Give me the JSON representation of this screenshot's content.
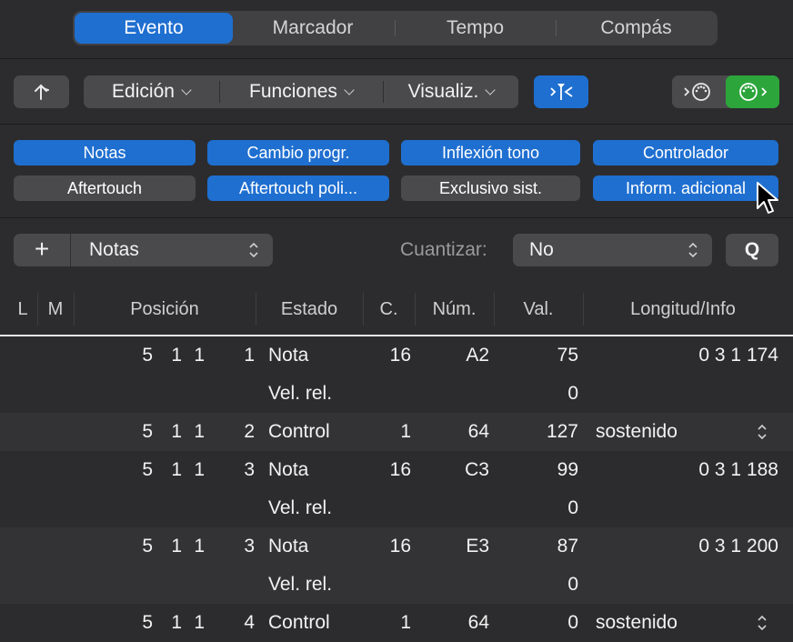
{
  "tabs": [
    "Evento",
    "Marcador",
    "Tempo",
    "Compás"
  ],
  "toolbar": {
    "up_button_icon": "arrow-up-icon",
    "edicion_label": "Edición",
    "funciones_label": "Funciones",
    "visualiz_label": "Visualiz.",
    "midi_in_icon": "midi-in-icon",
    "midi_out_icon": "midi-out-icon",
    "catch_icon": "catch-playhead-icon"
  },
  "filters": [
    {
      "label": "Notas",
      "on": true
    },
    {
      "label": "Cambio progr.",
      "on": true
    },
    {
      "label": "Inflexión tono",
      "on": true
    },
    {
      "label": "Controlador",
      "on": true
    },
    {
      "label": "Aftertouch",
      "on": false
    },
    {
      "label": "Aftertouch poli...",
      "on": true
    },
    {
      "label": "Exclusivo sist.",
      "on": false
    },
    {
      "label": "Inform. adicional",
      "on": true
    }
  ],
  "create": {
    "add_label": "+",
    "type_value": "Notas",
    "quantize_label": "Cuantizar:",
    "quantize_value": "No",
    "q_label": "Q"
  },
  "columns": [
    "L",
    "M",
    "Posición",
    "Estado",
    "C.",
    "Núm.",
    "Val.",
    "Longitud/Info"
  ],
  "rows": [
    {
      "pos": [
        "5",
        "1",
        "1",
        "1"
      ],
      "estado": "Nota",
      "c": "16",
      "num": "A2",
      "val": "75",
      "info": "0 3 1 174"
    },
    {
      "pos": [
        "",
        "",
        "",
        ""
      ],
      "estado": "Vel. rel.",
      "c": "",
      "num": "",
      "val": "0",
      "info": ""
    },
    {
      "pos": [
        "5",
        "1",
        "1",
        "2"
      ],
      "estado": "Control",
      "c": "1",
      "num": "64",
      "val": "127",
      "info": "sostenido"
    },
    {
      "pos": [
        "5",
        "1",
        "1",
        "3"
      ],
      "estado": "Nota",
      "c": "16",
      "num": "C3",
      "val": "99",
      "info": "0 3 1 188"
    },
    {
      "pos": [
        "",
        "",
        "",
        ""
      ],
      "estado": "Vel. rel.",
      "c": "",
      "num": "",
      "val": "0",
      "info": ""
    },
    {
      "pos": [
        "5",
        "1",
        "1",
        "3"
      ],
      "estado": "Nota",
      "c": "16",
      "num": "E3",
      "val": "87",
      "info": "0 3 1 200"
    },
    {
      "pos": [
        "",
        "",
        "",
        ""
      ],
      "estado": "Vel. rel.",
      "c": "",
      "num": "",
      "val": "0",
      "info": ""
    },
    {
      "pos": [
        "5",
        "1",
        "1",
        "4"
      ],
      "estado": "Control",
      "c": "1",
      "num": "64",
      "val": "0",
      "info": "sostenido"
    }
  ],
  "colors": {
    "accent": "#1f6fd0",
    "green": "#2ca53b",
    "background": "#2c2c2e"
  }
}
